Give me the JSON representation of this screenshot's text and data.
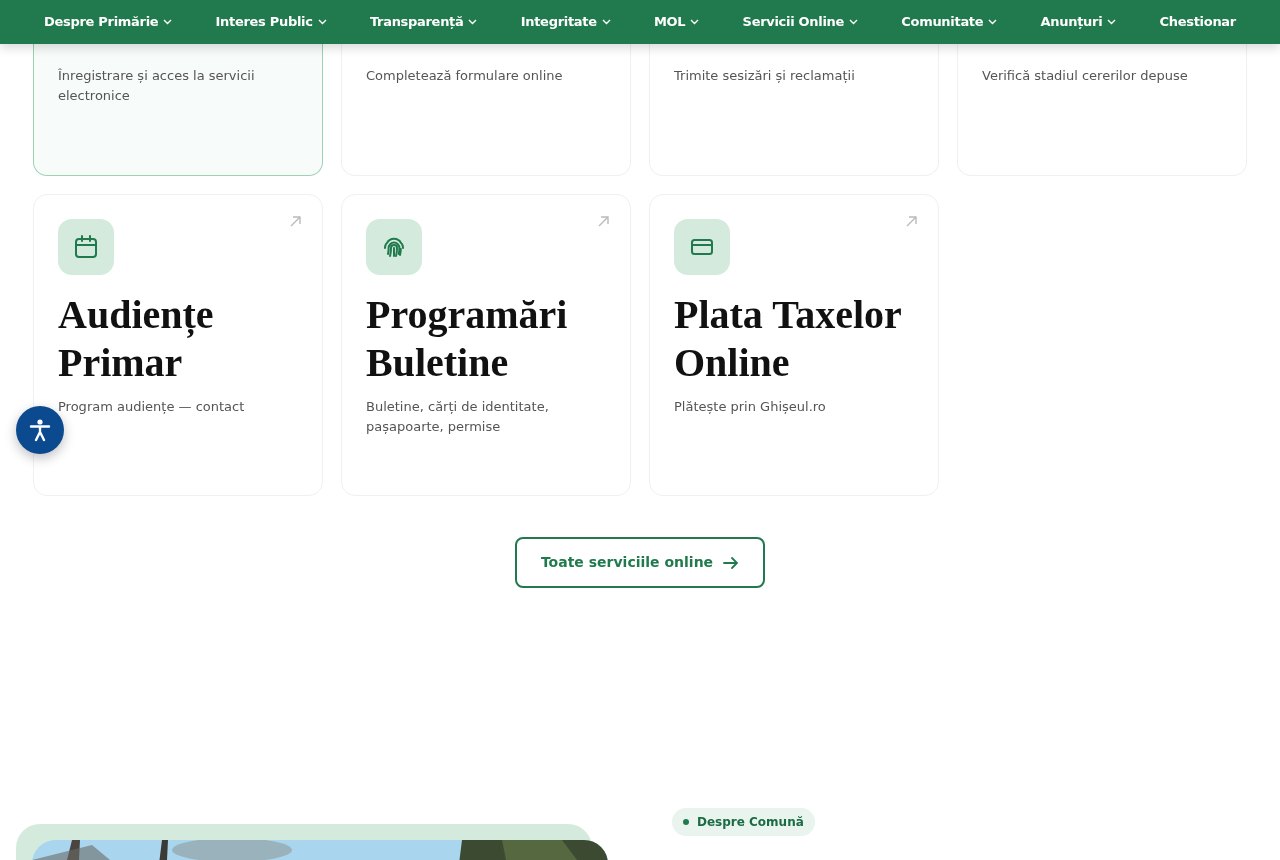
{
  "nav": {
    "items": [
      {
        "label": "Despre Primărie",
        "dropdown": true
      },
      {
        "label": "Interes Public",
        "dropdown": true
      },
      {
        "label": "Transparență",
        "dropdown": true
      },
      {
        "label": "Integritate",
        "dropdown": true
      },
      {
        "label": "MOL",
        "dropdown": true
      },
      {
        "label": "Servicii Online",
        "dropdown": true
      },
      {
        "label": "Comunitate",
        "dropdown": true
      },
      {
        "label": "Anunțuri",
        "dropdown": true
      },
      {
        "label": "Chestionar",
        "dropdown": false
      }
    ]
  },
  "top_cards": [
    {
      "description": "Înregistrare și acces la servicii electronice",
      "highlighted": true
    },
    {
      "description": "Completează formulare online",
      "highlighted": false
    },
    {
      "description": "Trimite sesizări și reclamații",
      "highlighted": false
    },
    {
      "description": "Verifică stadiul cererilor depuse",
      "highlighted": false
    }
  ],
  "cards": [
    {
      "kind": "calendar",
      "title": "Audiențe Primar",
      "description": "Program audiențe — contact"
    },
    {
      "kind": "fingerprint",
      "title": "Programări Buletine",
      "description": "Buletine, cărți de identitate, pașapoarte, permise"
    },
    {
      "kind": "credit-card",
      "title": "Plata Taxelor Online",
      "description": "Plătește prin Ghișeul.ro"
    }
  ],
  "all_services_button": {
    "label": "Toate serviciile online"
  },
  "about": {
    "badge": "Despre Comună"
  }
}
